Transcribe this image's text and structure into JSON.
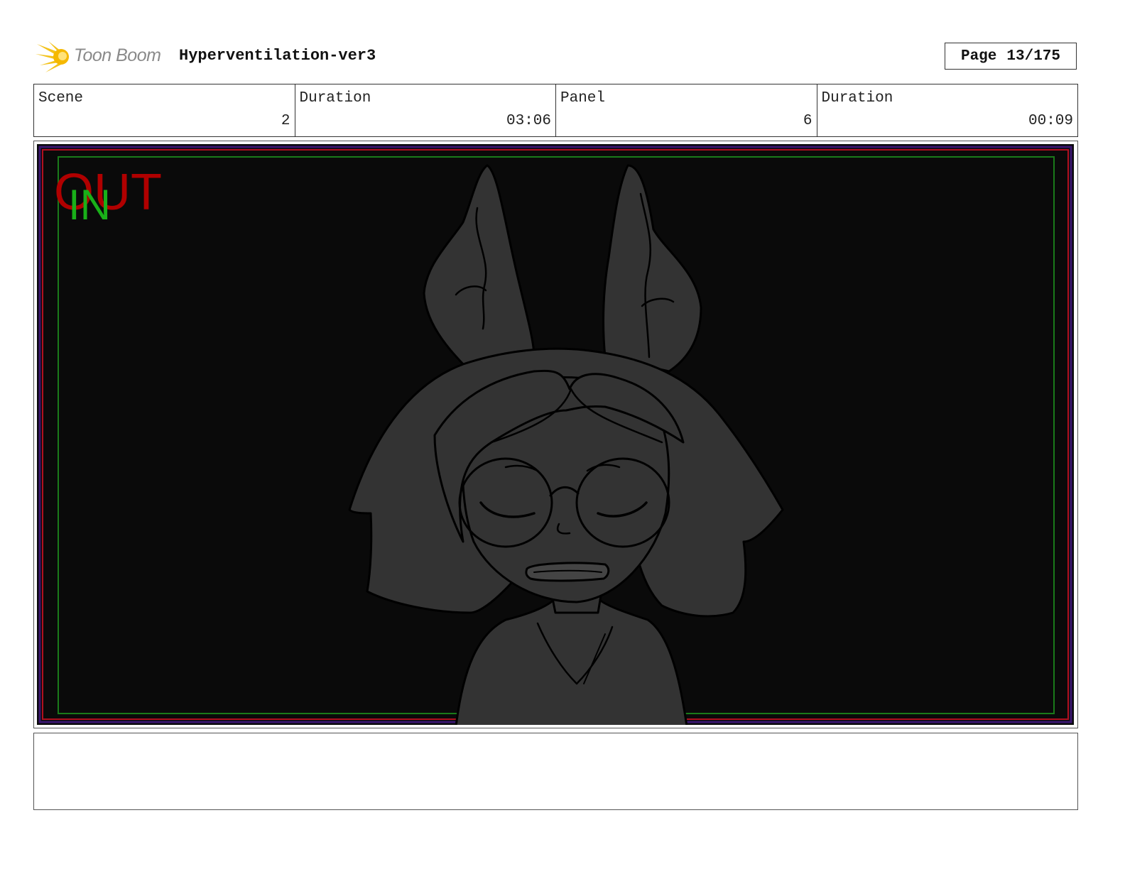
{
  "header": {
    "logo_text": "Toon Boom",
    "title": "Hyperventilation-ver3",
    "page_label": "Page",
    "page_number": "13/175"
  },
  "info": {
    "scene_label": "Scene",
    "scene_value": "2",
    "scene_duration_label": "Duration",
    "scene_duration_value": "03:06",
    "panel_label": "Panel",
    "panel_value": "6",
    "panel_duration_label": "Duration",
    "panel_duration_value": "00:09"
  },
  "panel": {
    "out_label": "OUT",
    "in_label": "IN",
    "out_color": "#b00000",
    "in_color": "#19b019",
    "safe_frame_color": "#1a7a1a",
    "outer_frame_color": "#b01020"
  },
  "notes": {
    "text": ""
  }
}
